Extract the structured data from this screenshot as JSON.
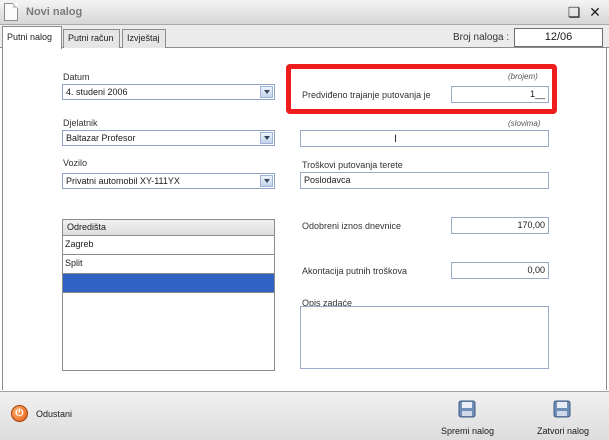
{
  "window": {
    "title": "Novi nalog"
  },
  "tabs": [
    {
      "label": "Putni nalog",
      "active": true
    },
    {
      "label": "Putni račun",
      "active": false
    },
    {
      "label": "Izvještaj",
      "active": false
    }
  ],
  "header": {
    "broj_label": "Broj naloga :",
    "broj_value": "12/06"
  },
  "form": {
    "datum": {
      "label": "Datum",
      "value": "4. studeni 2006"
    },
    "djelatnik": {
      "label": "Djelatnik",
      "value": "Baltazar Profesor"
    },
    "vozilo": {
      "label": "Vozilo",
      "value": "Privatni automobil XY-111YX"
    },
    "trajanje": {
      "hint": "(brojem)",
      "label": "Predviđeno trajanje putovanja je",
      "value": "1__"
    },
    "slovima": {
      "hint": "(slovima)",
      "value": ""
    },
    "troskovi": {
      "label": "Troškovi putovanja terete",
      "value": "Poslodavca"
    },
    "dnevnica": {
      "label": "Odobreni iznos dnevnice",
      "value": "170,00"
    },
    "akontacija": {
      "label": "Akontacija putnih troškova",
      "value": "0,00"
    },
    "opis": {
      "label": "Opis zadaće",
      "value": ""
    }
  },
  "destinations": {
    "header": "Odredišta",
    "items": [
      "Zagreb",
      "Split",
      ""
    ]
  },
  "toolbar": {
    "cancel_label": "Odustani",
    "save_label": "Spremi nalog",
    "close_label": "Zatvori nalog"
  },
  "colors": {
    "highlight": "#ee1c1c",
    "selection": "#2f62c2"
  }
}
